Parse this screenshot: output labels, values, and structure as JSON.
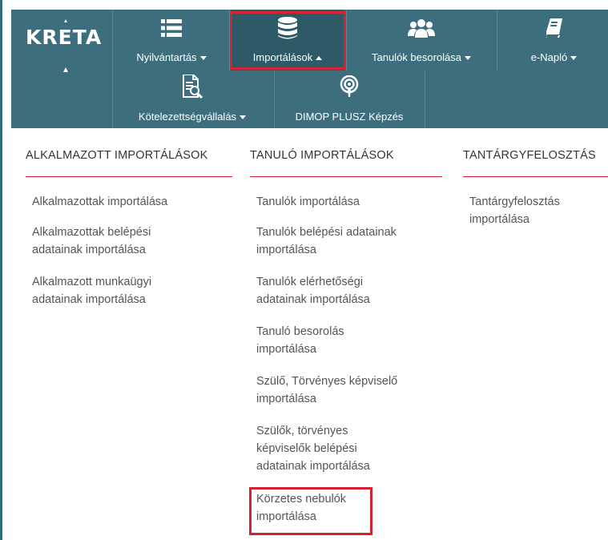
{
  "brand": {
    "logo_text": "KRETA"
  },
  "nav": {
    "row1": [
      {
        "label": "Nyilvántartás",
        "icon": "list-icon",
        "dropdown": "down"
      },
      {
        "label": "Importálások",
        "icon": "database-icon",
        "dropdown": "up",
        "active": true
      },
      {
        "label": "Tanulók besorolása",
        "icon": "users-icon",
        "dropdown": "down"
      },
      {
        "label": "e-Napló",
        "icon": "book-icon",
        "dropdown": "down"
      }
    ],
    "row2": [
      {
        "label": "Kötelezettségvállalás",
        "icon": "document-search-icon",
        "dropdown": "down"
      },
      {
        "label": "DIMOP PLUSZ Képzés",
        "icon": "podcast-icon"
      }
    ]
  },
  "columns": [
    {
      "heading": "ALKALMAZOTT IMPORTÁLÁSOK",
      "links": [
        "Alkalmazottak importálása",
        "Alkalmazottak belépési\nadatainak importálása",
        "Alkalmazott munkaügyi\nadatainak importálása"
      ]
    },
    {
      "heading": "TANULÓ IMPORTÁLÁSOK",
      "links": [
        "Tanulók importálása",
        "Tanulók belépési adatainak\nimportálása",
        "Tanulók elérhetőségi\nadatainak importálása",
        "Tanuló besorolás\nimportálása",
        "Szülő, Törvényes képviselő\nimportálása",
        "Szülők, törvényes\nképviselők belépési\nadatainak importálása",
        "Körzetes nebulók\nimportálása"
      ]
    },
    {
      "heading": "TANTÁRGYFELOSZTÁS",
      "links": [
        "Tantárgyfelosztás\nimportálása"
      ]
    }
  ],
  "colors": {
    "navbar": "#3c6e7e",
    "active_nav": "#2e5a68",
    "highlight_border": "#d62231",
    "heading_rule": "#d62231"
  }
}
